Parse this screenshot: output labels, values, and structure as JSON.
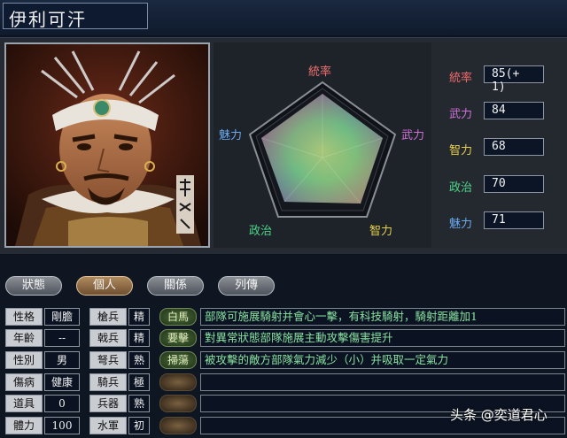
{
  "general": {
    "name": "伊利可汗"
  },
  "radar": {
    "labels": {
      "top": "統率",
      "right": "武力",
      "bottom_right": "智力",
      "bottom_left": "政治",
      "left": "魅力"
    }
  },
  "stats": [
    {
      "label": "統率",
      "value": "85(+ 1)",
      "color": "#f06a6a"
    },
    {
      "label": "武力",
      "value": "84",
      "color": "#d070d8"
    },
    {
      "label": "智力",
      "value": "68",
      "color": "#e6d04a"
    },
    {
      "label": "政治",
      "value": "70",
      "color": "#4fd48a"
    },
    {
      "label": "魅力",
      "value": "71",
      "color": "#6aaaf0"
    }
  ],
  "tabs": [
    {
      "label": "狀態",
      "active": false
    },
    {
      "label": "個人",
      "active": true
    },
    {
      "label": "關係",
      "active": false
    },
    {
      "label": "列傳",
      "active": false
    }
  ],
  "personal": [
    {
      "label": "性格",
      "value": "剛膽"
    },
    {
      "label": "年齡",
      "value": "--"
    },
    {
      "label": "性別",
      "value": "男"
    },
    {
      "label": "傷病",
      "value": "健康"
    },
    {
      "label": "道具",
      "value": "0"
    },
    {
      "label": "體力",
      "value": "100"
    }
  ],
  "troops": [
    {
      "label": "槍兵",
      "value": "精"
    },
    {
      "label": "戟兵",
      "value": "精"
    },
    {
      "label": "弩兵",
      "value": "熟"
    },
    {
      "label": "騎兵",
      "value": "極"
    },
    {
      "label": "兵器",
      "value": "熟"
    },
    {
      "label": "水軍",
      "value": "初"
    }
  ],
  "skills": [
    {
      "name": "白馬",
      "desc": "部隊可施展騎射并會心一擊，有科技騎射，騎射距離加1"
    },
    {
      "name": "要擊",
      "desc": "對異常狀態部隊施展主動攻擊傷害提升"
    },
    {
      "name": "掃蕩",
      "desc": "被攻擊的敵方部隊氣力減少（小）并吸取一定氣力"
    },
    {
      "name": "",
      "desc": ""
    },
    {
      "name": "",
      "desc": ""
    },
    {
      "name": "",
      "desc": ""
    }
  ],
  "watermark": "头条 @奕道君心"
}
